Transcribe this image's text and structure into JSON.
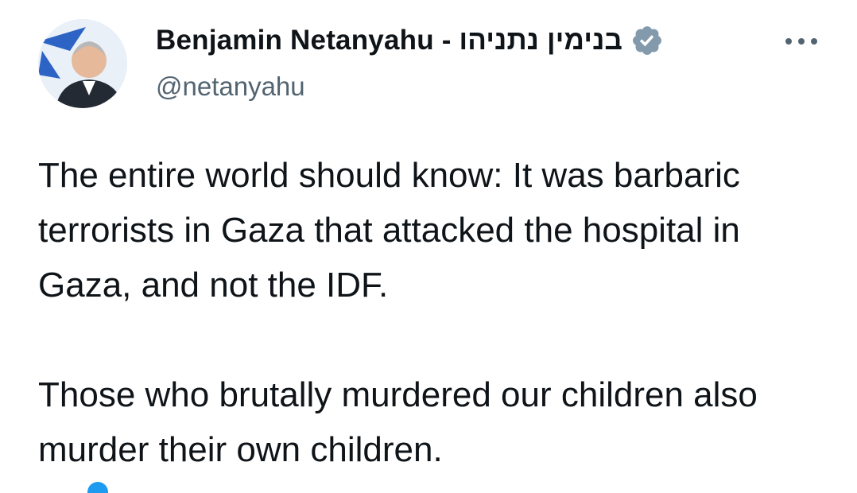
{
  "author": {
    "display_name": "Benjamin Netanyahu - בנימין נתניהו",
    "handle": "@netanyahu",
    "verified": true,
    "verified_color": "#829aab"
  },
  "tweet": {
    "paragraphs": [
      "The entire world should know: It was barbaric terrorists in Gaza that attacked the hospital in Gaza, and not the IDF.",
      "Those who brutally murdered our children also murder their own children."
    ]
  },
  "icons": {
    "more": "more-horizontal-icon",
    "verified": "verified-badge-icon"
  },
  "colors": {
    "text": "#0f1419",
    "secondary": "#536471",
    "accent": "#1d9bf0"
  }
}
